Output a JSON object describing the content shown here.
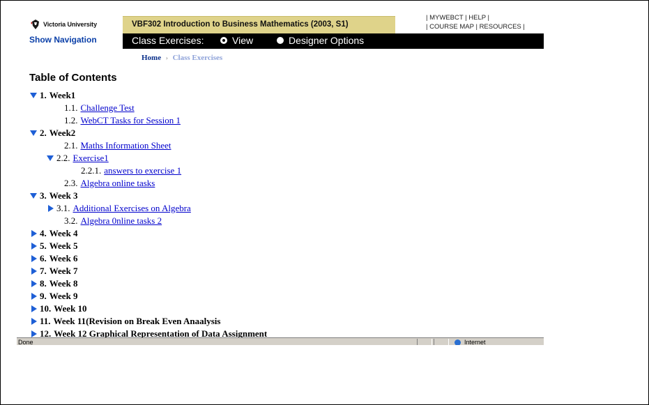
{
  "header": {
    "logo_text": "Victoria University",
    "show_navigation": "Show Navigation",
    "course_title": "VBF302 Introduction to Business Mathematics (2003, S1)",
    "top_links": {
      "mywebct": "MYWEBCT",
      "help": "HELP",
      "course_map": "COURSE MAP",
      "resources": "RESOURCES",
      "separator": "|"
    }
  },
  "context_bar": {
    "label": "Class Exercises:",
    "options": [
      {
        "label": "View",
        "selected": true
      },
      {
        "label": "Designer Options",
        "selected": false
      }
    ]
  },
  "breadcrumb": {
    "home": "Home",
    "separator": "›",
    "current": "Class Exercises"
  },
  "toc": {
    "title": "Table of Contents",
    "rows": [
      {
        "num": "1.",
        "label": "Week1",
        "level": 1,
        "expander": "down"
      },
      {
        "num": "1.1.",
        "label": "Challenge Test",
        "level": 2,
        "expander": "none"
      },
      {
        "num": "1.2.",
        "label": "WebCT Tasks for Session 1",
        "level": 2,
        "expander": "none"
      },
      {
        "num": "2.",
        "label": "Week2",
        "level": 1,
        "expander": "down"
      },
      {
        "num": "2.1.",
        "label": "Maths Information Sheet",
        "level": 2,
        "expander": "none"
      },
      {
        "num": "2.2.",
        "label": "Exercise1",
        "level": 2,
        "expander": "down"
      },
      {
        "num": "2.2.1.",
        "label": "answers to exercise 1",
        "level": 3,
        "expander": "none"
      },
      {
        "num": "2.3.",
        "label": "Algebra online tasks",
        "level": 2,
        "expander": "none"
      },
      {
        "num": "3.",
        "label": "Week 3",
        "level": 1,
        "expander": "down"
      },
      {
        "num": "3.1.",
        "label": "Additional Exercises on Algebra",
        "level": 2,
        "expander": "right"
      },
      {
        "num": "3.2.",
        "label": "Algebra 0nline tasks 2",
        "level": 2,
        "expander": "none"
      },
      {
        "num": "4.",
        "label": "Week 4",
        "level": 1,
        "expander": "right"
      },
      {
        "num": "5.",
        "label": "Week 5",
        "level": 1,
        "expander": "right"
      },
      {
        "num": "6.",
        "label": "Week 6",
        "level": 1,
        "expander": "right"
      },
      {
        "num": "7.",
        "label": "Week 7",
        "level": 1,
        "expander": "right"
      },
      {
        "num": "8.",
        "label": "Week 8",
        "level": 1,
        "expander": "right"
      },
      {
        "num": "9.",
        "label": "Week 9",
        "level": 1,
        "expander": "right"
      },
      {
        "num": "10.",
        "label": "Week 10",
        "level": 1,
        "expander": "right"
      },
      {
        "num": "11.",
        "label": "Week 11(Revision on Break Even Anaalysis",
        "level": 1,
        "expander": "right"
      },
      {
        "num": "12.",
        "label": "Week 12 Graphical Representation of Data Assignment",
        "level": 1,
        "expander": "right"
      }
    ]
  },
  "status_bar": {
    "status": "Done",
    "zone": "Internet"
  },
  "colors": {
    "course_bar": "#dfd38a",
    "link": "#0000cc",
    "expander": "#1e5fd6",
    "nav_link": "#0a3fa8"
  }
}
